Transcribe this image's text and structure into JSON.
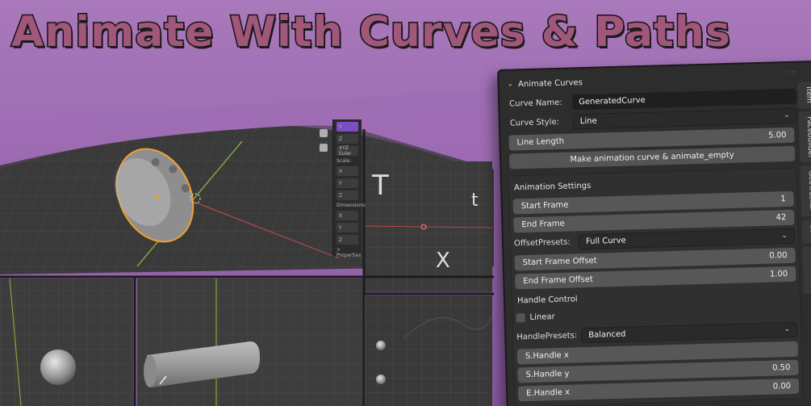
{
  "banner": {
    "title": "Animate With Curves & Paths"
  },
  "colors": {
    "background": "#9a68b0",
    "title_fill": "#a0577a",
    "title_outline": "#141414",
    "selection_outline": "#f0a030",
    "panel_bg": "#2d2d2d",
    "field_bg": "#575757"
  },
  "viewport": {
    "properties_panel": {
      "items": [
        "Y",
        "Z",
        "XYZ Euler",
        "Scale:",
        "X",
        "Y",
        "Z",
        "Dimensions:",
        "X",
        "Y",
        "Z",
        "> Properties"
      ]
    },
    "right_view_letters": {
      "top": "T",
      "bottom": "X",
      "small": "t"
    }
  },
  "addon": {
    "panel_title": "Animate Curves",
    "curve_name_label": "Curve Name:",
    "curve_name_value": "GeneratedCurve",
    "curve_style_label": "Curve Style:",
    "curve_style_value": "Line",
    "line_length_label": "Line Length",
    "line_length_value": "5.00",
    "make_button": "Make animation curve & animate_empty",
    "animation_settings": {
      "title": "Animation Settings",
      "start_frame_label": "Start Frame",
      "start_frame_value": "1",
      "end_frame_label": "End Frame",
      "end_frame_value": "42",
      "offset_presets_label": "OffsetPresets:",
      "offset_presets_value": "Full Curve",
      "start_offset_label": "Start Frame Offset",
      "start_offset_value": "0.00",
      "end_offset_label": "End Frame Offset",
      "end_offset_value": "1.00",
      "handle_control_label": "Handle Control",
      "linear_label": "Linear",
      "handle_presets_label": "HandlePresets:",
      "handle_presets_value": "Balanced",
      "shandle_x_label": "S.Handle x",
      "shandle_y_label": "S.Handle y",
      "shandle_y_value": "0.50",
      "ehandle_x_label": "E.Handle x",
      "ehandle_x_value": "0.00"
    },
    "tabs": [
      "Item",
      "Facebuilder",
      "GeoTracker",
      "Edit",
      "BlenderKit"
    ]
  }
}
